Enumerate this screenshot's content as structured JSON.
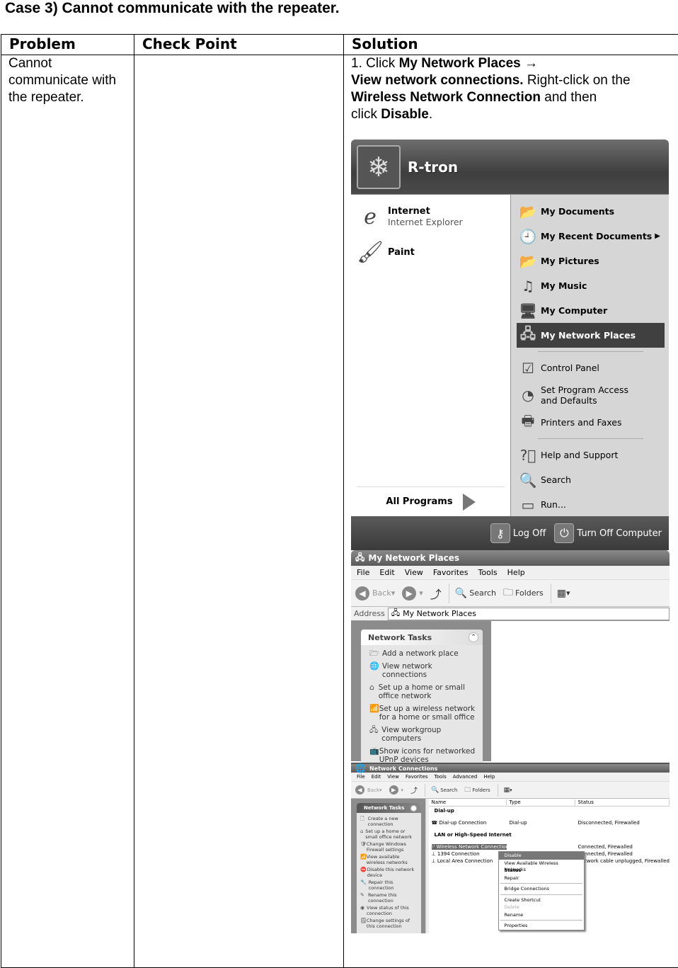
{
  "case_title": "Case 3) Cannot communicate with the repeater.",
  "table": {
    "headers": [
      "Problem",
      "Check Point",
      "Solution"
    ],
    "problem": "Cannot communicate with the repeater.",
    "check_point": "",
    "solution": {
      "step_prefix": "1. Click ",
      "b1": "My Network Places",
      "arrow": " →",
      "b2": "View network connections.",
      "t2": " Right-click on the",
      "b3": "Wireless Network Connection",
      "t3": " and then",
      "t4": "click ",
      "b4": "Disable",
      "t5": "."
    }
  },
  "start_menu": {
    "user_name": "R-tron",
    "pinned": [
      {
        "label": "Internet",
        "sub": "Internet Explorer",
        "icon": "internet-explorer-icon"
      },
      {
        "label": "Paint",
        "sub": "",
        "icon": "paint-icon"
      }
    ],
    "all_programs": "All Programs",
    "right_items": [
      {
        "label": "My Documents",
        "bold": true,
        "icon": "my-documents-icon"
      },
      {
        "label": "My Recent Documents",
        "bold": true,
        "icon": "recent-documents-icon",
        "submenu": true
      },
      {
        "label": "My Pictures",
        "bold": true,
        "icon": "my-pictures-icon"
      },
      {
        "label": "My Music",
        "bold": true,
        "icon": "my-music-icon"
      },
      {
        "label": "My Computer",
        "bold": true,
        "icon": "my-computer-icon"
      },
      {
        "label": "My Network Places",
        "bold": true,
        "icon": "network-places-icon",
        "highlighted": true
      },
      {
        "label": "Control Panel",
        "icon": "control-panel-icon"
      },
      {
        "label": "Set Program Access and Defaults",
        "icon": "program-access-icon"
      },
      {
        "label": "Printers and Faxes",
        "icon": "printer-icon"
      },
      {
        "label": "Help and Support",
        "icon": "help-icon"
      },
      {
        "label": "Search",
        "icon": "search-icon"
      },
      {
        "label": "Run...",
        "icon": "run-icon"
      }
    ],
    "log_off": "Log Off",
    "turn_off": "Turn Off Computer"
  },
  "network_places_window": {
    "title": "My Network Places",
    "menu": [
      "File",
      "Edit",
      "View",
      "Favorites",
      "Tools",
      "Help"
    ],
    "toolbar": {
      "back": "Back",
      "search": "Search",
      "folders": "Folders"
    },
    "address_label": "Address",
    "address_value": "My Network Places",
    "tasks_title": "Network Tasks",
    "tasks": [
      "Add a network place",
      "View network connections",
      "Set up a home or small office network",
      "Set up a wireless network for a home or small office",
      "View workgroup computers",
      "Show icons for networked UPnP devices"
    ]
  },
  "network_connections_window": {
    "title": "Network Connections",
    "menu": [
      "File",
      "Edit",
      "View",
      "Favorites",
      "Tools",
      "Advanced",
      "Help"
    ],
    "toolbar": {
      "back": "Back",
      "search": "Search",
      "folders": "Folders"
    },
    "tasks_title": "Network Tasks",
    "tasks": [
      "Create a new connection",
      "Set up a home or small office network",
      "Change Windows Firewall settings",
      "View available wireless networks",
      "Disable this network device",
      "Repair this connection",
      "Rename this connection",
      "View status of this connection",
      "Change settings of this connection"
    ],
    "columns": [
      "Name",
      "Type",
      "Status"
    ],
    "group1": "Dial-up",
    "dialup": {
      "name": "Dial-up Connection",
      "type": "Dial-up",
      "status": "Disconnected, Firewalled"
    },
    "group2": "LAN or High-Speed Internet",
    "lan_rows": [
      {
        "name": "Wireless Network Connection",
        "type": "",
        "status": "Connected, Firewalled",
        "selected": true
      },
      {
        "name": "1394 Connection",
        "type": "",
        "status": "Connected, Firewalled"
      },
      {
        "name": "Local Area Connection",
        "type": "",
        "status": "Network cable unplugged, Firewalled"
      }
    ],
    "context_menu": {
      "disable": "Disable",
      "view_wireless": "View Available Wireless Networks",
      "status": "Status",
      "repair": "Repair",
      "bridge": "Bridge Connections",
      "shortcut": "Create Shortcut",
      "delete": "Delete",
      "rename": "Rename",
      "properties": "Properties"
    }
  }
}
